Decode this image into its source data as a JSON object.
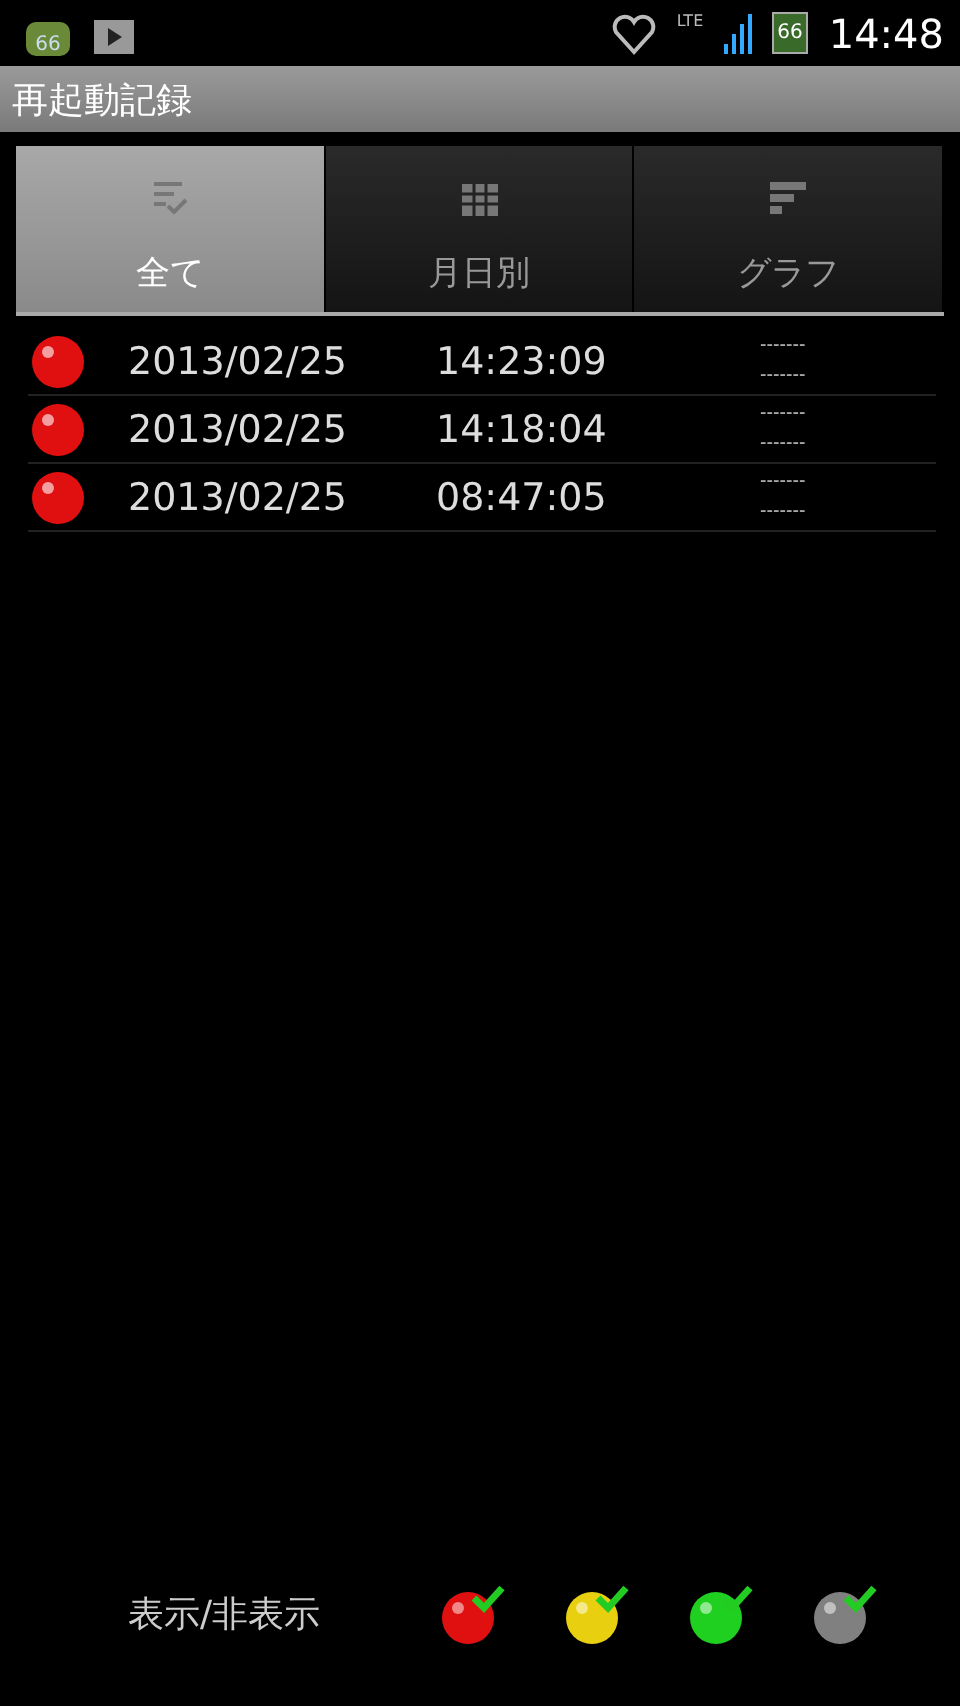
{
  "status_bar": {
    "badge": "66",
    "battery": "66",
    "network": "LTE",
    "time": "14:48"
  },
  "title": "再起動記録",
  "tabs": [
    {
      "label": "全て",
      "selected": true
    },
    {
      "label": "月日別",
      "selected": false
    },
    {
      "label": "グラフ",
      "selected": false
    }
  ],
  "rows": [
    {
      "color": "#e01010",
      "date": "2013/02/25",
      "time": "14:23:09",
      "column_3": [
        "-------",
        "-------"
      ]
    },
    {
      "color": "#e01010",
      "date": "2013/02/25",
      "time": "14:18:04",
      "column_3": [
        "-------",
        "-------"
      ]
    },
    {
      "color": "#e01010",
      "date": "2013/02/25",
      "time": "08:47:05",
      "column_3": [
        "-------",
        "-------"
      ]
    }
  ],
  "footer": {
    "label": "表示/非表示",
    "filters": [
      {
        "color": "#e01010",
        "checked": true
      },
      {
        "color": "#e8d010",
        "checked": true
      },
      {
        "color": "#20d020",
        "checked": true
      },
      {
        "color": "#808080",
        "checked": true
      }
    ]
  }
}
